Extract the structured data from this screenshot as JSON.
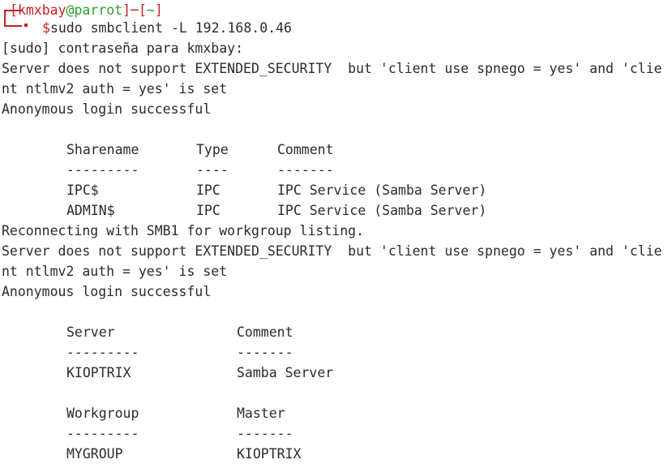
{
  "prompt": {
    "open_bracket": "[",
    "user": "kmxbay",
    "at": "@",
    "host": "parrot",
    "close_bracket": "]",
    "separator": "─",
    "dir_open": "[",
    "dir": "~",
    "dir_close": "]",
    "dollar": "$",
    "command": "sudo smbclient -L 192.168.0.46"
  },
  "output": {
    "line1": "[sudo] contraseña para kmxbay:",
    "line2": "Server does not support EXTENDED_SECURITY  but 'client use spnego = yes' and 'clie",
    "line3": "nt ntlmv2 auth = yes' is set",
    "line4": "Anonymous login successful",
    "shares_header": {
      "col1": "Sharename",
      "col2": "Type",
      "col3": "Comment"
    },
    "shares_dash": {
      "col1": "---------",
      "col2": "----",
      "col3": "-------"
    },
    "shares": [
      {
        "name": "IPC$",
        "type": "IPC",
        "comment": "IPC Service (Samba Server)"
      },
      {
        "name": "ADMIN$",
        "type": "IPC",
        "comment": "IPC Service (Samba Server)"
      }
    ],
    "line5": "Reconnecting with SMB1 for workgroup listing.",
    "line6": "Server does not support EXTENDED_SECURITY  but 'client use spnego = yes' and 'clie",
    "line7": "nt ntlmv2 auth = yes' is set",
    "line8": "Anonymous login successful",
    "server_header": {
      "col1": "Server",
      "col2": "Comment"
    },
    "server_dash": {
      "col1": "---------",
      "col2": "-------"
    },
    "servers": [
      {
        "name": "KIOPTRIX",
        "comment": "Samba Server"
      }
    ],
    "workgroup_header": {
      "col1": "Workgroup",
      "col2": "Master"
    },
    "workgroup_dash": {
      "col1": "---------",
      "col2": "-------"
    },
    "workgroups": [
      {
        "name": "MYGROUP",
        "master": "KIOPTRIX"
      }
    ]
  },
  "colors": {
    "prompt_red": "#cc1e1e",
    "host_green": "#2e9e2e",
    "text": "#2b2b2b",
    "background": "#ffffff"
  }
}
